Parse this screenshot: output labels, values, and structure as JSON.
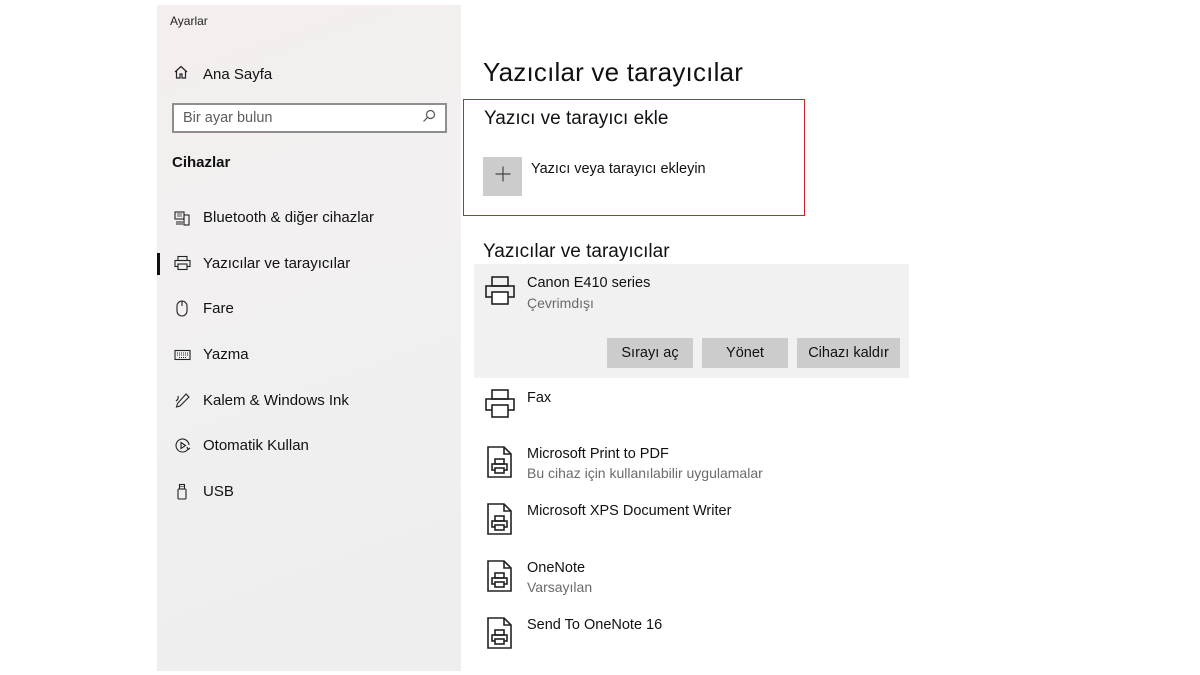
{
  "window": {
    "title": "Ayarlar"
  },
  "sidebar": {
    "home_label": "Ana Sayfa",
    "search_placeholder": "Bir ayar bulun",
    "section_label": "Cihazlar",
    "items": [
      {
        "label": "Bluetooth & diğer cihazlar",
        "icon": "bluetooth-devices-icon",
        "active": false
      },
      {
        "label": "Yazıcılar ve tarayıcılar",
        "icon": "printer-icon",
        "active": true
      },
      {
        "label": "Fare",
        "icon": "mouse-icon",
        "active": false
      },
      {
        "label": "Yazma",
        "icon": "keyboard-icon",
        "active": false
      },
      {
        "label": "Kalem & Windows Ink",
        "icon": "pen-icon",
        "active": false
      },
      {
        "label": "Otomatik Kullan",
        "icon": "autoplay-icon",
        "active": false
      },
      {
        "label": "USB",
        "icon": "usb-icon",
        "active": false
      }
    ]
  },
  "main": {
    "title": "Yazıcılar ve tarayıcılar",
    "add_section": {
      "title": "Yazıcı ve tarayıcı ekle",
      "add_label": "Yazıcı veya tarayıcı ekleyin",
      "highlight_color": "#d2202f"
    },
    "list_title": "Yazıcılar ve tarayıcılar",
    "devices": [
      {
        "name": "Canon E410 series",
        "status": "Çevrimdışı",
        "icon": "printer-icon",
        "selected": true
      },
      {
        "name": "Fax",
        "status": "",
        "icon": "printer-icon",
        "selected": false
      },
      {
        "name": "Microsoft Print to PDF",
        "status": "Bu cihaz için kullanılabilir uygulamalar",
        "icon": "document-printer-icon",
        "selected": false
      },
      {
        "name": "Microsoft XPS Document Writer",
        "status": "",
        "icon": "document-printer-icon",
        "selected": false
      },
      {
        "name": "OneNote",
        "status": "Varsayılan",
        "icon": "document-printer-icon",
        "selected": false
      },
      {
        "name": "Send To OneNote 16",
        "status": "",
        "icon": "document-printer-icon",
        "selected": false
      }
    ],
    "device_actions": {
      "open_queue": "Sırayı aç",
      "manage": "Yönet",
      "remove": "Cihazı kaldır"
    }
  }
}
